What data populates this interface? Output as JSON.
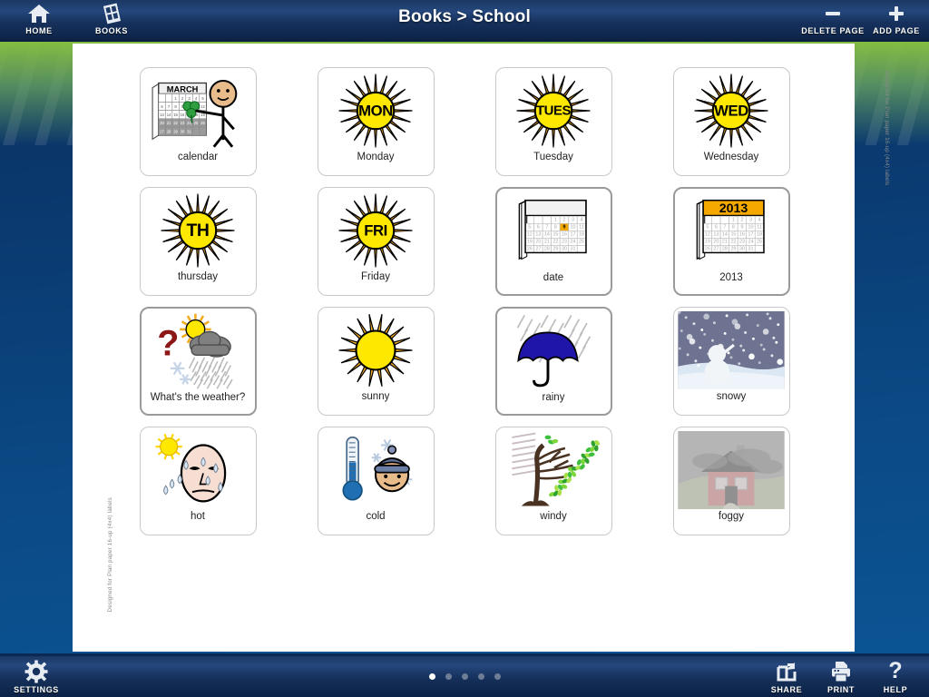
{
  "header": {
    "title": "Books > School",
    "home_label": "HOME",
    "books_label": "BOOKS",
    "delete_page_label": "DELETE PAGE",
    "add_page_label": "ADD PAGE",
    "home_icon": "house-icon",
    "books_icon": "books-grid-icon",
    "delete_icon": "minus-icon",
    "add_icon": "plus-icon"
  },
  "footer": {
    "settings_label": "SETTINGS",
    "share_label": "SHARE",
    "print_label": "PRINT",
    "help_label": "HELP",
    "settings_icon": "gear-icon",
    "share_icon": "share-arrow-icon",
    "print_icon": "printer-icon",
    "help_icon": "question-mark-icon",
    "page_dots": {
      "count": 5,
      "active_index": 0
    }
  },
  "watermark": {
    "right": "Designed for Plan paper 16-up (4x4) labels",
    "left": "Designed for Plan paper 16-up (4x4) labels"
  },
  "colors": {
    "topbar": "#16315c",
    "background_blue": "#0b4a86",
    "accent_green": "#8ac33d",
    "sun_yellow": "#ffe800",
    "sun_ray_orange": "#f0a91e",
    "calendar_orange": "#f5a800",
    "umbrella_blue": "#1f15a8",
    "dot_active": "#ffffff"
  },
  "cards": [
    {
      "label": "calendar",
      "icon": "calendar-march-person-icon",
      "art": "calendar-person",
      "emphasis": false,
      "month": "MARCH"
    },
    {
      "label": "Monday",
      "icon": "sun-mon-icon",
      "art": "sun-text",
      "emphasis": false,
      "sun_text": "MON"
    },
    {
      "label": "Tuesday",
      "icon": "sun-tues-icon",
      "art": "sun-text",
      "emphasis": false,
      "sun_text": "TUES"
    },
    {
      "label": "Wednesday",
      "icon": "sun-wed-icon",
      "art": "sun-text",
      "emphasis": false,
      "sun_text": "WED"
    },
    {
      "label": "thursday",
      "icon": "sun-th-icon",
      "art": "sun-text",
      "emphasis": false,
      "sun_text": "TH"
    },
    {
      "label": "Friday",
      "icon": "sun-fri-icon",
      "art": "sun-text",
      "emphasis": false,
      "sun_text": "FRI"
    },
    {
      "label": "date",
      "icon": "calendar-date-icon",
      "art": "calendar-pad",
      "emphasis": true,
      "header_text": "",
      "highlight_day": "9"
    },
    {
      "label": "2013",
      "icon": "calendar-year-icon",
      "art": "calendar-pad",
      "emphasis": true,
      "header_text": "2013",
      "highlight_day": ""
    },
    {
      "label": "What's the weather?",
      "icon": "weather-question-icon",
      "art": "weather-question",
      "emphasis": true
    },
    {
      "label": "sunny",
      "icon": "sun-plain-icon",
      "art": "sun-plain",
      "emphasis": false
    },
    {
      "label": "rainy",
      "icon": "umbrella-rain-icon",
      "art": "umbrella",
      "emphasis": true
    },
    {
      "label": "snowy",
      "icon": "snowman-photo-icon",
      "art": "photo-snow",
      "emphasis": false
    },
    {
      "label": "hot",
      "icon": "sweating-face-sun-icon",
      "art": "hot-face",
      "emphasis": false
    },
    {
      "label": "cold",
      "icon": "thermometer-cold-face-icon",
      "art": "cold",
      "emphasis": false
    },
    {
      "label": "windy",
      "icon": "windy-tree-icon",
      "art": "windy",
      "emphasis": false
    },
    {
      "label": "foggy",
      "icon": "foggy-house-photo-icon",
      "art": "photo-fog",
      "emphasis": false
    }
  ],
  "calendar_grid": {
    "rows": [
      [
        "",
        "",
        "1",
        "2",
        "3",
        "4"
      ],
      [
        "5",
        "6",
        "7",
        "8",
        "9",
        "10",
        "11"
      ],
      [
        "12",
        "13",
        "14",
        "15",
        "16",
        "17",
        "18"
      ],
      [
        "19",
        "20",
        "21",
        "22",
        "23",
        "24",
        "25"
      ],
      [
        "26",
        "27",
        "28",
        "29",
        "30",
        "31",
        ""
      ]
    ]
  }
}
